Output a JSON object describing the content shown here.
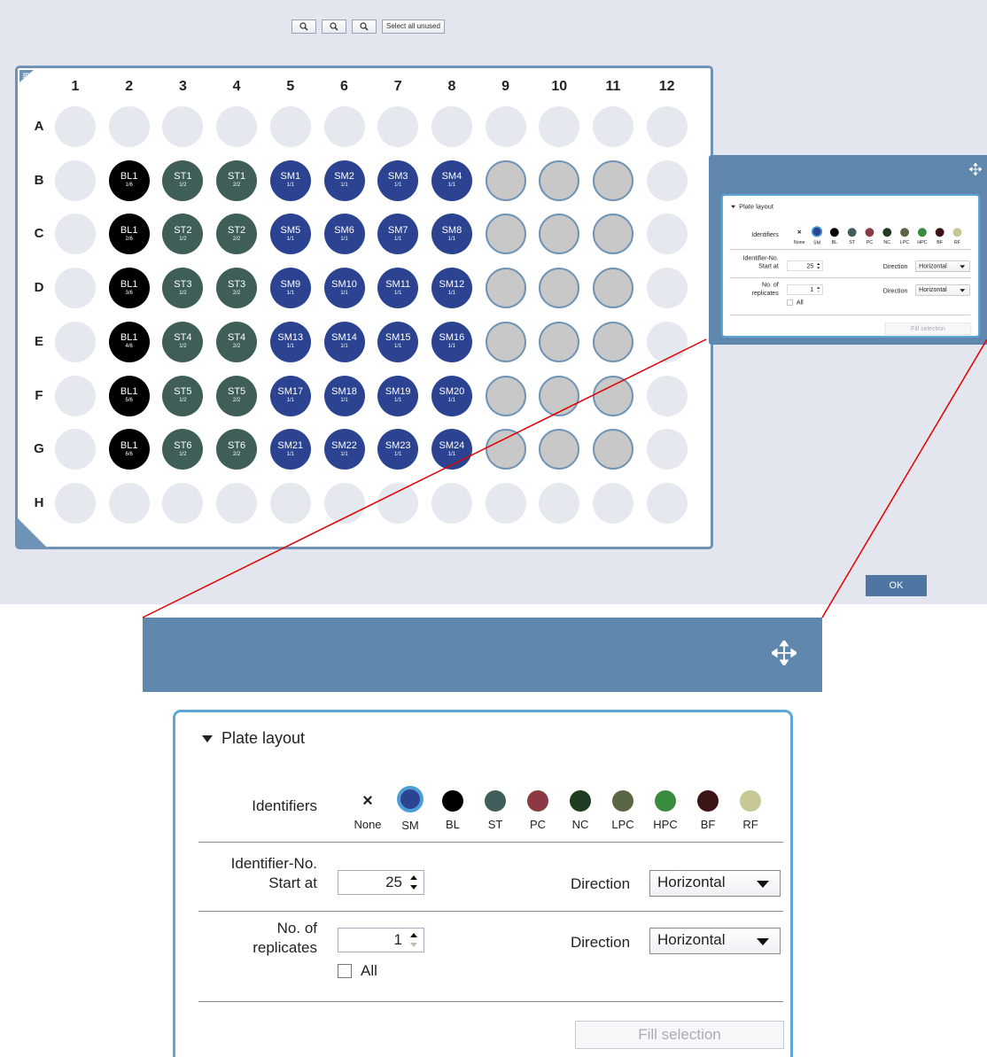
{
  "toolbar": {
    "zoom_in_icon": "zoom-in-icon",
    "zoom_reset_icon": "zoom-reset-icon",
    "zoom_out_icon": "zoom-out-icon",
    "select_all_unused": "Select all unused"
  },
  "plate": {
    "columns": [
      "1",
      "2",
      "3",
      "4",
      "5",
      "6",
      "7",
      "8",
      "9",
      "10",
      "11",
      "12"
    ],
    "rows": [
      "A",
      "B",
      "C",
      "D",
      "E",
      "F",
      "G",
      "H"
    ],
    "wells": {
      "B": [
        [
          "",
          ""
        ],
        [
          "BL1",
          "1/6"
        ],
        [
          "ST1",
          "1/2"
        ],
        [
          "ST1",
          "2/2"
        ],
        [
          "SM1",
          "1/1"
        ],
        [
          "SM2",
          "1/1"
        ],
        [
          "SM3",
          "1/1"
        ],
        [
          "SM4",
          "1/1"
        ]
      ],
      "C": [
        [
          "",
          ""
        ],
        [
          "BL1",
          "2/6"
        ],
        [
          "ST2",
          "1/2"
        ],
        [
          "ST2",
          "2/2"
        ],
        [
          "SM5",
          "1/1"
        ],
        [
          "SM6",
          "1/1"
        ],
        [
          "SM7",
          "1/1"
        ],
        [
          "SM8",
          "1/1"
        ]
      ],
      "D": [
        [
          "",
          ""
        ],
        [
          "BL1",
          "3/6"
        ],
        [
          "ST3",
          "1/2"
        ],
        [
          "ST3",
          "2/2"
        ],
        [
          "SM9",
          "1/1"
        ],
        [
          "SM10",
          "1/1"
        ],
        [
          "SM11",
          "1/1"
        ],
        [
          "SM12",
          "1/1"
        ]
      ],
      "E": [
        [
          "",
          ""
        ],
        [
          "BL1",
          "4/6"
        ],
        [
          "ST4",
          "1/2"
        ],
        [
          "ST4",
          "2/2"
        ],
        [
          "SM13",
          "1/1"
        ],
        [
          "SM14",
          "1/1"
        ],
        [
          "SM15",
          "1/1"
        ],
        [
          "SM16",
          "1/1"
        ]
      ],
      "F": [
        [
          "",
          ""
        ],
        [
          "BL1",
          "5/6"
        ],
        [
          "ST5",
          "1/2"
        ],
        [
          "ST5",
          "2/2"
        ],
        [
          "SM17",
          "1/1"
        ],
        [
          "SM18",
          "1/1"
        ],
        [
          "SM19",
          "1/1"
        ],
        [
          "SM20",
          "1/1"
        ]
      ],
      "G": [
        [
          "",
          ""
        ],
        [
          "BL1",
          "6/6"
        ],
        [
          "ST6",
          "1/2"
        ],
        [
          "ST6",
          "2/2"
        ],
        [
          "SM21",
          "1/1"
        ],
        [
          "SM22",
          "1/1"
        ],
        [
          "SM23",
          "1/1"
        ],
        [
          "SM24",
          "1/1"
        ]
      ]
    }
  },
  "plate_layout": {
    "heading": "Plate layout",
    "identifiers_label": "Identifiers",
    "identifiers": [
      {
        "code": "None",
        "color": "",
        "symbol": "×"
      },
      {
        "code": "SM",
        "color": "#2b4390",
        "symbol": ""
      },
      {
        "code": "BL",
        "color": "#000000",
        "symbol": ""
      },
      {
        "code": "ST",
        "color": "#3f5e5c",
        "symbol": ""
      },
      {
        "code": "PC",
        "color": "#8b3a45",
        "symbol": ""
      },
      {
        "code": "NC",
        "color": "#1f3b22",
        "symbol": ""
      },
      {
        "code": "LPC",
        "color": "#5c6642",
        "symbol": ""
      },
      {
        "code": "HPC",
        "color": "#3a8a3f",
        "symbol": ""
      },
      {
        "code": "BF",
        "color": "#3d1416",
        "symbol": ""
      },
      {
        "code": "RF",
        "color": "#c6c792",
        "symbol": ""
      }
    ],
    "start_label_1": "Identifier-No.",
    "start_label_2": "Start at",
    "start_value": "25",
    "direction_label": "Direction",
    "direction_value_1": "Horizontal",
    "replicates_label_1": "No. of",
    "replicates_label_2": "replicates",
    "replicates_value": "1",
    "direction_value_2": "Horizontal",
    "all_label": "All",
    "fill_selection": "Fill selection"
  },
  "ok_button": "OK",
  "colors": {
    "panel_header": "#6087ae",
    "plate_border": "#6e93b6",
    "callout_line": "#e00000"
  }
}
